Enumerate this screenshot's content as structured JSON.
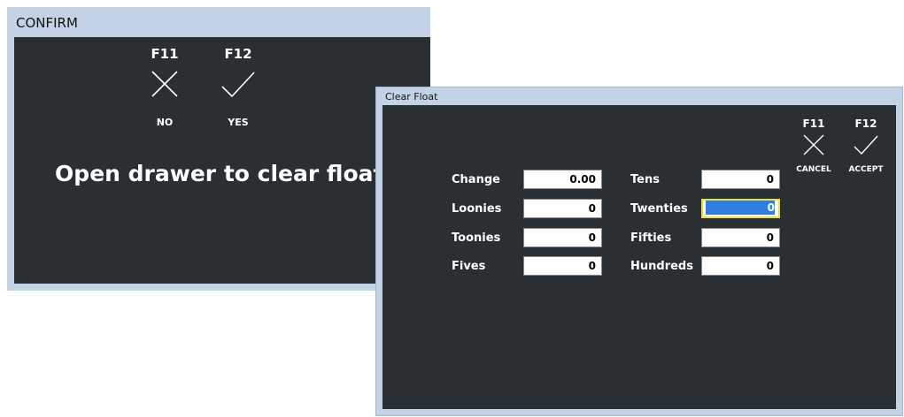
{
  "confirm": {
    "title": "CONFIRM",
    "no": {
      "key": "F11",
      "label": "NO",
      "icon": "close-icon"
    },
    "yes": {
      "key": "F12",
      "label": "YES",
      "icon": "check-icon"
    },
    "message": "Open drawer to clear float?"
  },
  "clear_float": {
    "title": "Clear Float",
    "cancel": {
      "key": "F11",
      "label": "CANCEL",
      "icon": "close-icon"
    },
    "accept": {
      "key": "F12",
      "label": "ACCEPT",
      "icon": "check-icon"
    },
    "fields": {
      "change": {
        "label": "Change",
        "value": "0.00"
      },
      "loonies": {
        "label": "Loonies",
        "value": "0"
      },
      "toonies": {
        "label": "Toonies",
        "value": "0"
      },
      "fives": {
        "label": "Fives",
        "value": "0"
      },
      "tens": {
        "label": "Tens",
        "value": "0"
      },
      "twenties": {
        "label": "Twenties",
        "value": "0"
      },
      "fifties": {
        "label": "Fifties",
        "value": "0"
      },
      "hundreds": {
        "label": "Hundreds",
        "value": "0"
      }
    },
    "focused_field": "twenties"
  },
  "colors": {
    "panel_bg": "#2a2f34",
    "titlebar_bg": "#c3d3e6",
    "focus_border": "#e8e23a",
    "selection": "#2f7fe0"
  }
}
